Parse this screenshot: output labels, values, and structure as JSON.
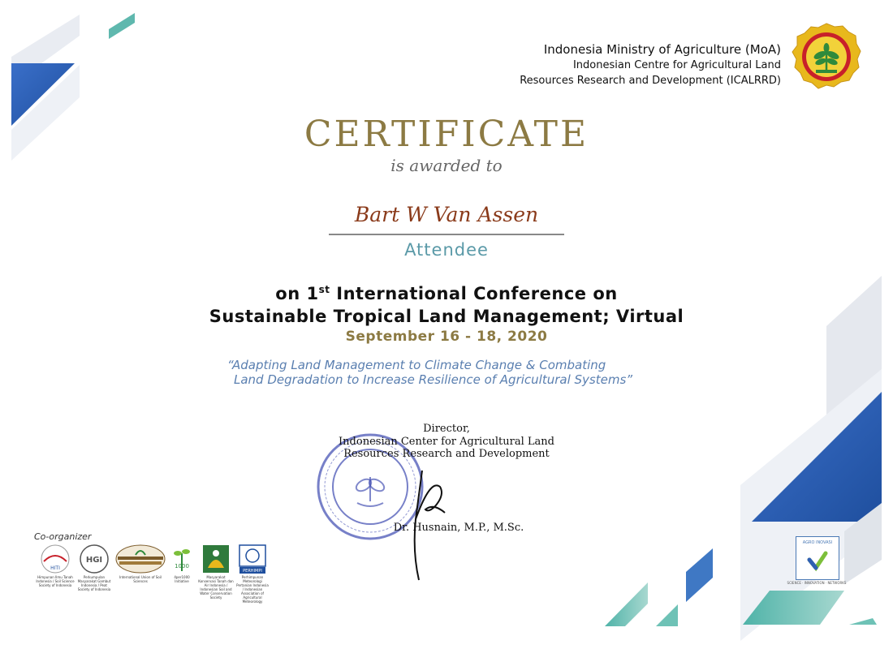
{
  "header": {
    "line1": "Indonesia Ministry of Agriculture (MoA)",
    "line2": "Indonesian Centre for Agricultural Land",
    "line3": "Resources Research and Development (ICALRRD)"
  },
  "certificate": {
    "title": "CERTIFICATE",
    "subtitle": "is awarded to",
    "recipient": "Bart W Van Assen",
    "role": "Attendee",
    "conference_prefix": "on 1",
    "conference_sup": "st",
    "conference_line1_rest": " International Conference on",
    "conference_line2": "Sustainable Tropical Land Management; Virtual",
    "dates": "September 16 - 18, 2020",
    "theme_line1": "“Adapting Land Management to Climate Change & Combating",
    "theme_line2": "Land Degradation to Increase Resilience of Agricultural Systems”"
  },
  "signatory": {
    "title": "Director,",
    "org_line1": "Indonesian Center for Agricultural Land",
    "org_line2": "Resources Research and Development",
    "name": "Dr. Husnain, M.P., M.Sc."
  },
  "co_organizers": {
    "label": "Co-organizer",
    "items": [
      {
        "abbr": "HITI",
        "caption": "Himpunan Ilmu Tanah Indonesia / Soil Science Society of Indonesia"
      },
      {
        "abbr": "HGI",
        "caption": "Perkumpulan Masyarakat Gambut Indonesia / Peat Society of Indonesia"
      },
      {
        "abbr": "",
        "caption": "International Union of Soil Sciences"
      },
      {
        "abbr": "1000",
        "caption": "4per1000 Initiative"
      },
      {
        "abbr": "",
        "caption": "Masyarakat Konservasi Tanah dan Air Indonesia / Indonesian Soil and Water Conservation Society"
      },
      {
        "abbr": "PERHIMPI",
        "caption": "Perhimpunan Meteorologi Pertanian Indonesia / Indonesian Association of Agricultural Meteorology"
      }
    ]
  },
  "agro_inovasi": {
    "title": "AGRO INOVASI",
    "tagline": "SCIENCE · INNOVATION · NETWORKS"
  },
  "colors": {
    "gold": "#8c7a43",
    "teal": "#5b9aa8",
    "blue": "#2f5fb3",
    "theme_blue": "#5a7fb0"
  }
}
